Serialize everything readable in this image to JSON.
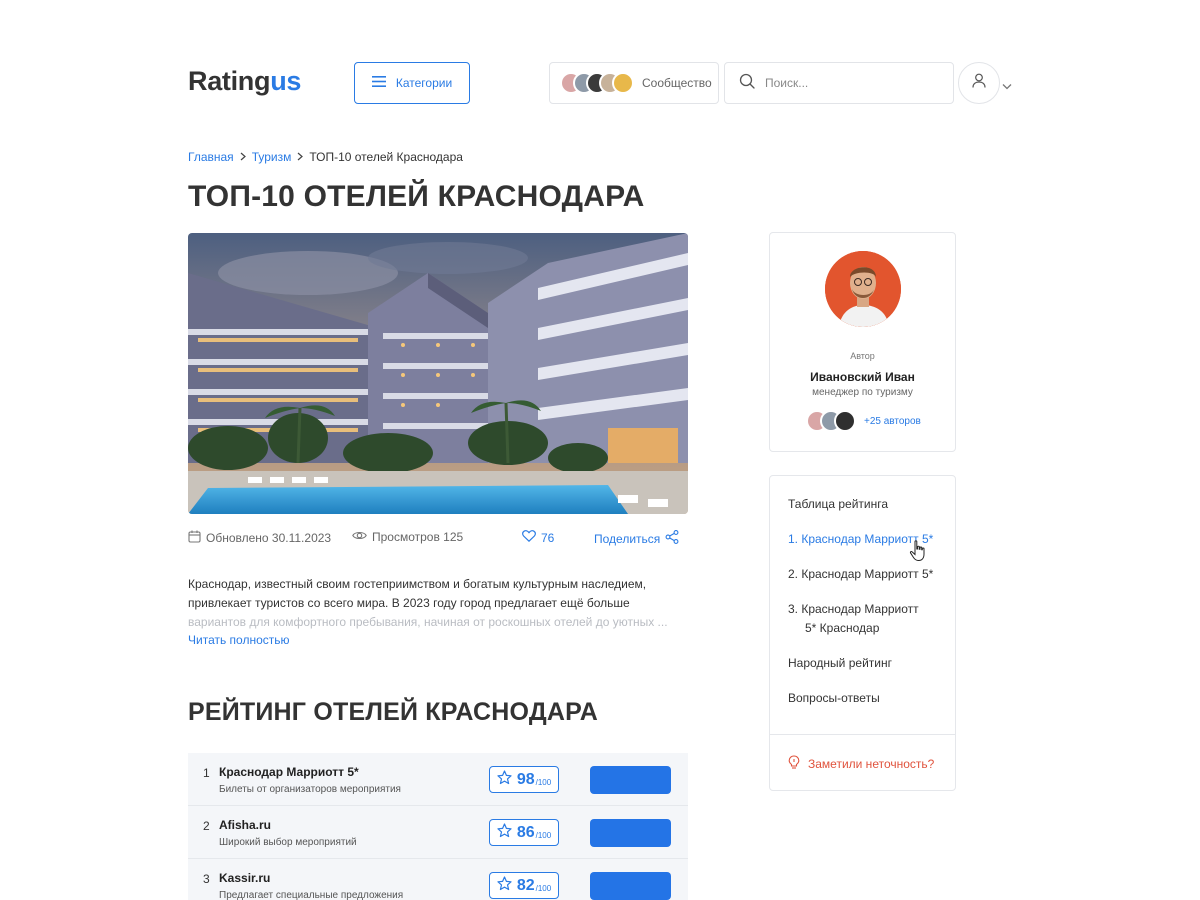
{
  "header": {
    "logo_main": "Rating",
    "logo_accent": "us",
    "categories_label": "Категории",
    "community_label": "Сообщество",
    "search_placeholder": "Поиск..."
  },
  "breadcrumb": {
    "home": "Главная",
    "section": "Туризм",
    "current": "ТОП-10 отелей Краснодара"
  },
  "page_title": "ТОП-10 ОТЕЛЕЙ КРАСНОДАРА",
  "meta": {
    "updated": "Обновлено 30.11.2023",
    "views": "Просмотров 125",
    "likes": "76",
    "share": "Поделиться"
  },
  "intro": {
    "text": "Краснодар, известный своим гостеприимством и богатым культурным наследием, привлекает туристов со всего мира. В 2023 году город предлагает ещё больше",
    "faded": "вариантов для комфортного пребывания, начиная от роскошных отелей до уютных ...",
    "read_more": "Читать полностью"
  },
  "rating_title": "РЕЙТИНГ ОТЕЛЕЙ КРАСНОДАРА",
  "rating": {
    "denominator": "/100",
    "rows": [
      {
        "num": "1",
        "name": "Краснодар Марриотт 5*",
        "sub": "Билеты от организаторов мероприятия",
        "score": "98"
      },
      {
        "num": "2",
        "name": "Afisha.ru",
        "sub": "Широкий выбор мероприятий",
        "score": "86"
      },
      {
        "num": "3",
        "name": "Kassir.ru",
        "sub": "Предлагает специальные предложения",
        "score": "82"
      }
    ]
  },
  "author": {
    "role": "Автор",
    "name": "Ивановский Иван",
    "position": "менеджер по туризму",
    "more": "+25 авторов"
  },
  "toc": {
    "heading": "Таблица рейтинга",
    "item1": "1.  Краснодар Марриотт 5*",
    "item2": "2.  Краснодар Марриотт 5*",
    "item3_line1": "3.  Краснодар Марриотт",
    "item3_line2": "5* Краснодар",
    "people": "Народный рейтинг",
    "faq": "Вопросы-ответы",
    "report": "Заметили неточность?"
  },
  "colors": {
    "accent": "#2a7be4",
    "button": "#2474e6",
    "warning": "#e0533d"
  },
  "icons": [
    "menu-icon",
    "search-icon",
    "user-icon",
    "chevron-down-icon",
    "calendar-icon",
    "eye-icon",
    "heart-icon",
    "share-icon",
    "star-icon",
    "lightbulb-icon",
    "pointer-cursor-icon"
  ]
}
